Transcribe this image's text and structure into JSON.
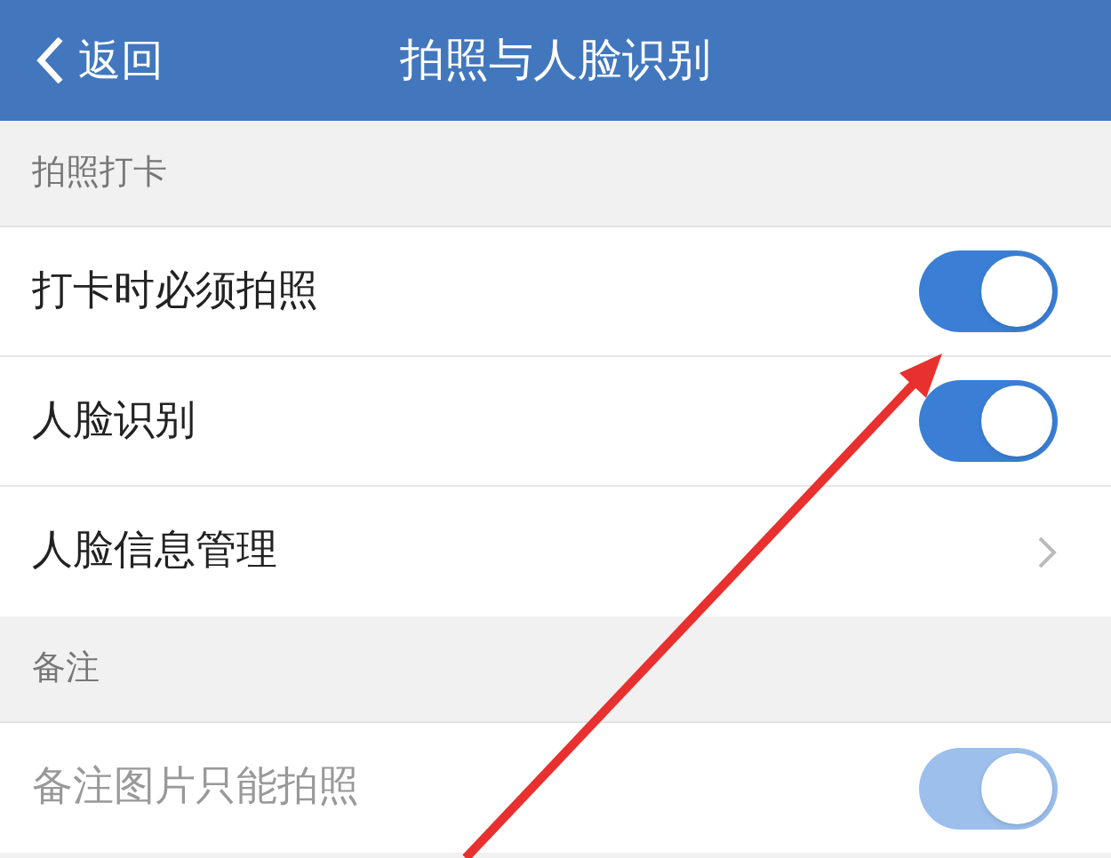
{
  "nav": {
    "back": "返回",
    "title": "拍照与人脸识别"
  },
  "sections": [
    {
      "title": "拍照打卡",
      "rows": [
        {
          "kind": "toggle",
          "label": "打卡时必须拍照",
          "on": true,
          "disabled": false
        },
        {
          "kind": "toggle",
          "label": "人脸识别",
          "on": true,
          "disabled": false
        },
        {
          "kind": "link",
          "label": "人脸信息管理"
        }
      ]
    },
    {
      "title": "备注",
      "rows": [
        {
          "kind": "toggle",
          "label": "备注图片只能拍照",
          "on": true,
          "disabled": true
        }
      ]
    }
  ]
}
